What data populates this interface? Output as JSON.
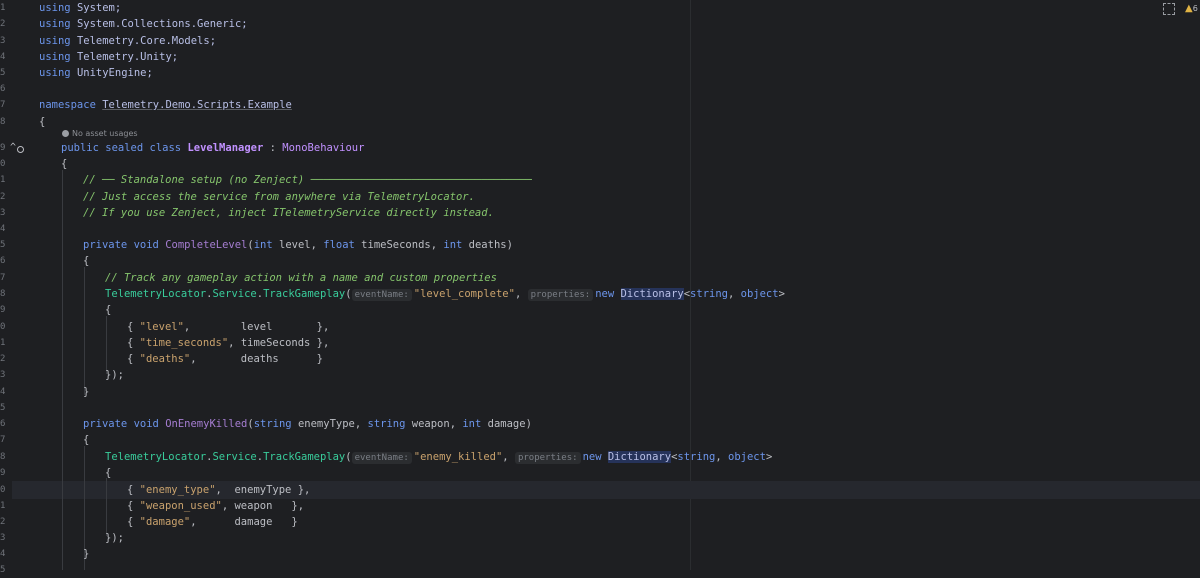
{
  "editor": {
    "line_numbers": [
      "1",
      "2",
      "3",
      "4",
      "5",
      "6",
      "7",
      "8",
      "9",
      "0",
      "1",
      "2",
      "3",
      "4",
      "5",
      "6",
      "7",
      "8",
      "9",
      "0",
      "1",
      "2",
      "3",
      "4",
      "5",
      "6",
      "7",
      "8",
      "9",
      "0",
      "1",
      "2",
      "3",
      "4",
      "5"
    ],
    "usage_hint": "No asset usages",
    "warning_count": "6"
  },
  "code": {
    "l1": {
      "kw": "using",
      "ns": "System;"
    },
    "l2": {
      "kw": "using",
      "ns": "System.Collections.Generic;"
    },
    "l3": {
      "kw": "using",
      "ns": "Telemetry.Core.Models;"
    },
    "l4": {
      "kw": "using",
      "ns": "Telemetry.Unity;"
    },
    "l5": {
      "kw": "using",
      "ns": "UnityEngine;"
    },
    "l7": {
      "kw": "namespace",
      "ns": "Telemetry.Demo.Scripts.Example"
    },
    "l8": "{",
    "l9": {
      "kw": "public sealed class",
      "cls": "LevelManager",
      "sep": " : ",
      "base": "MonoBehaviour"
    },
    "l10": "{",
    "l11": "// ── Standalone setup (no Zenject) ───────────────────────────────────",
    "l12": "// Just access the service from anywhere via TelemetryLocator.",
    "l13": "// If you use Zenject, inject ITelemetryService directly instead.",
    "l15": {
      "kw": "private void",
      "name": "CompleteLevel",
      "p1t": "int",
      "p1": " level, ",
      "p2t": "float",
      "p2": " timeSeconds, ",
      "p3t": "int",
      "p3": " deaths)"
    },
    "l16": "{",
    "l17": "// Track any gameplay action with a name and custom properties",
    "l18": {
      "recv": "TelemetryLocator",
      "dot1": ".",
      "svc": "Service",
      "dot2": ".",
      "call": "TrackGameplay",
      "open": "(",
      "hint1": "eventName:",
      "arg1": "\"level_complete\"",
      "comma": ", ",
      "hint2": "properties:",
      "new": "new",
      "dict": "Dictionary",
      "generic": "<",
      "t1": "string",
      "gsep": ", ",
      "t2": "object",
      "gclose": ">"
    },
    "l19": "{",
    "l20": {
      "open": "{ ",
      "key": "\"level\"",
      "pad": ",        level       },"
    },
    "l21": {
      "open": "{ ",
      "key": "\"time_seconds\"",
      "pad": ", timeSeconds },"
    },
    "l22": {
      "open": "{ ",
      "key": "\"deaths\"",
      "pad": ",       deaths      }"
    },
    "l23": "});",
    "l24": "}",
    "l26": {
      "kw": "private void",
      "name": "OnEnemyKilled",
      "p1t": "string",
      "p1": " enemyType, ",
      "p2t": "string",
      "p2": " weapon, ",
      "p3t": "int",
      "p3": " damage)"
    },
    "l27": "{",
    "l28": {
      "recv": "TelemetryLocator",
      "dot1": ".",
      "svc": "Service",
      "dot2": ".",
      "call": "TrackGameplay",
      "open": "(",
      "hint1": "eventName:",
      "arg1": "\"enemy_killed\"",
      "comma": ", ",
      "hint2": "properties:",
      "new": "new",
      "dict": "Dictionary",
      "generic": "<",
      "t1": "string",
      "gsep": ", ",
      "t2": "object",
      "gclose": ">"
    },
    "l29": "{",
    "l30": {
      "open": "{ ",
      "key": "\"enemy_type\"",
      "pad": ",  enemyType },"
    },
    "l31": {
      "open": "{ ",
      "key": "\"weapon_used\"",
      "pad": ", weapon   },"
    },
    "l32": {
      "open": "{ ",
      "key": "\"damage\"",
      "pad": ",      damage   }"
    },
    "l33": "});",
    "l34": "}"
  },
  "colors": {
    "background": "#1e1f22",
    "keyword": "#6c95eb",
    "string": "#c9a26d",
    "comment": "#85c46c",
    "method": "#39cc9b",
    "type": "#c191ff"
  }
}
